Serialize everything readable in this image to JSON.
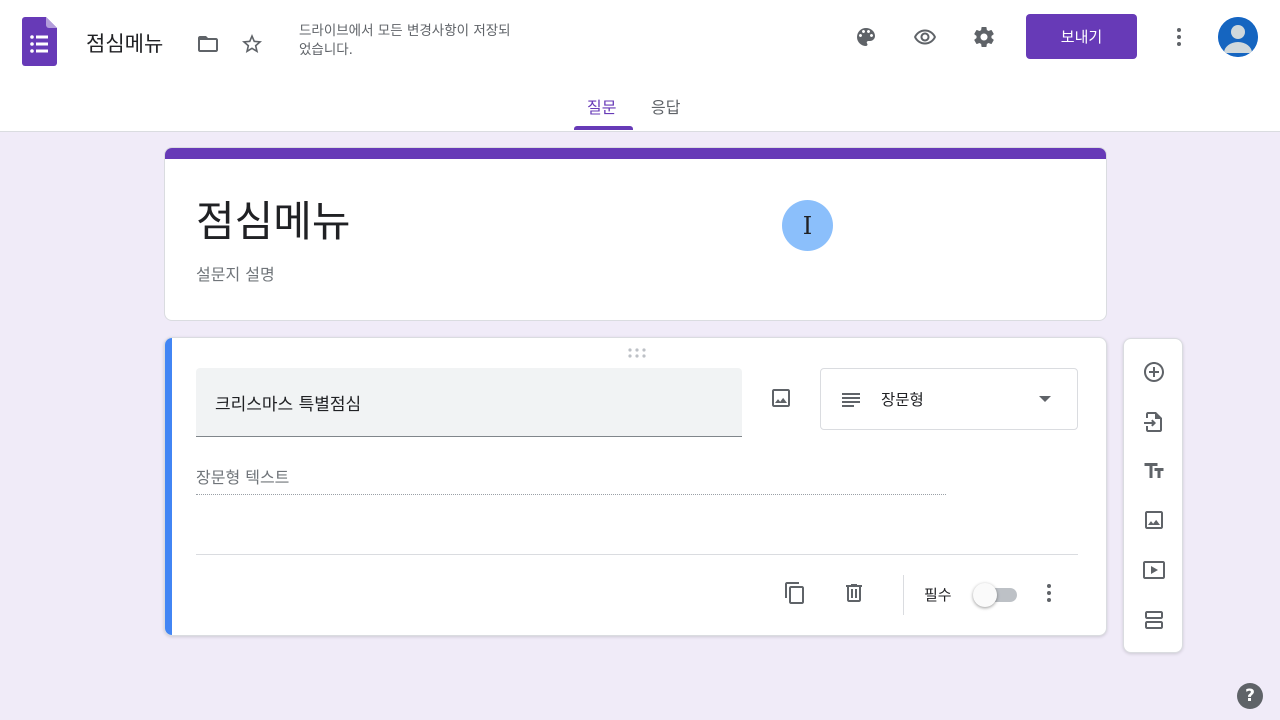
{
  "header": {
    "doc_title": "점심메뉴",
    "save_status": "드라이브에서 모든 변경사항이 저장되었습니다.",
    "send_label": "보내기",
    "tabs": [
      {
        "label": "질문",
        "active": true
      },
      {
        "label": "응답",
        "active": false
      }
    ],
    "icons": [
      "forms-logo-icon",
      "folder-icon",
      "star-icon",
      "palette-icon",
      "eye-icon",
      "gear-icon",
      "more-vert-icon",
      "avatar"
    ]
  },
  "form": {
    "title": "점심메뉴",
    "description_placeholder": "설문지 설명"
  },
  "question": {
    "title": "크리스마스 특별점심",
    "type_label": "장문형",
    "answer_placeholder": "장문형 텍스트",
    "required_label": "필수",
    "required": false
  },
  "side_toolbar": {
    "icons": [
      "add-question-icon",
      "import-questions-icon",
      "add-title-icon",
      "add-image-icon",
      "add-video-icon",
      "add-section-icon"
    ]
  },
  "help_label": "?",
  "colors": {
    "accent": "#673ab7",
    "background": "#f0ebf8",
    "question_accent": "#4285f4"
  }
}
